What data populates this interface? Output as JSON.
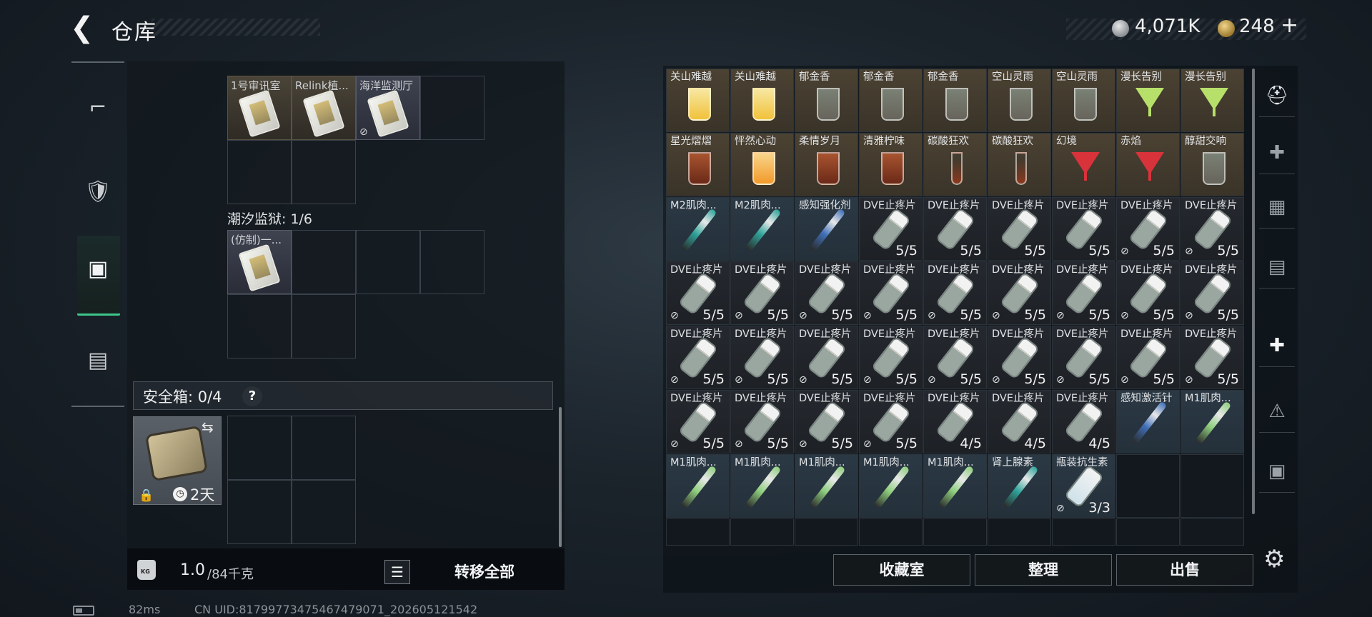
{
  "header": {
    "title": "仓库",
    "back_icon": "back-arrow-icon"
  },
  "currency": {
    "silver": "4,071K",
    "gold": "248",
    "gold_add": "+"
  },
  "left_nav": [
    {
      "name": "weapons",
      "icon": "pistol-icon",
      "glyph": "⌐"
    },
    {
      "name": "equipment",
      "icon": "armor-icon",
      "glyph": "🛡"
    },
    {
      "name": "backpack",
      "icon": "backpack-icon",
      "glyph": "▣"
    },
    {
      "name": "case",
      "icon": "briefcase-icon",
      "glyph": "▤"
    }
  ],
  "left_panel": {
    "section1_items": [
      {
        "label": "1号审讯室",
        "unpullable": false
      },
      {
        "label": "Relink植...",
        "unpullable": false
      },
      {
        "label": "海洋监测厅",
        "unpullable": true
      }
    ],
    "section2_title": "潮汐监狱: 1/6",
    "section2_items": [
      {
        "label": "(仿制)一..."
      }
    ],
    "safe_box_label": "安全箱: 0/4",
    "safe_box_help": "?",
    "case_days": "2天",
    "weight_value": "1.0",
    "weight_max": "/84千克",
    "transfer_all": "转移全部"
  },
  "footer": {
    "ping": "82ms",
    "uid": "CN UID:817997734754674790​71_202605121542"
  },
  "grid_rows": [
    [
      {
        "name": "关山难越",
        "type": "drink_yellow",
        "count": "",
        "nd": false
      },
      {
        "name": "关山难越",
        "type": "drink_yellow",
        "count": "",
        "nd": false
      },
      {
        "name": "郁金香",
        "type": "drink_clear",
        "count": "",
        "nd": false
      },
      {
        "name": "郁金香",
        "type": "drink_clear",
        "count": "",
        "nd": false
      },
      {
        "name": "郁金香",
        "type": "drink_clear",
        "count": "",
        "nd": false
      },
      {
        "name": "空山灵雨",
        "type": "drink_clear",
        "count": "",
        "nd": false
      },
      {
        "name": "空山灵雨",
        "type": "drink_clear",
        "count": "",
        "nd": false
      },
      {
        "name": "漫长告别",
        "type": "cocktail_green",
        "count": "",
        "nd": false
      },
      {
        "name": "漫长告别",
        "type": "cocktail_green",
        "count": "",
        "nd": false
      }
    ],
    [
      {
        "name": "星光熠熠",
        "type": "drink_dark",
        "count": "",
        "nd": false
      },
      {
        "name": "怦然心动",
        "type": "drink_orange",
        "count": "",
        "nd": false
      },
      {
        "name": "柔情岁月",
        "type": "drink_dark",
        "count": "",
        "nd": false
      },
      {
        "name": "清雅柠味",
        "type": "drink_dark",
        "count": "",
        "nd": false
      },
      {
        "name": "碳酸狂欢",
        "type": "flute",
        "count": "",
        "nd": false
      },
      {
        "name": "碳酸狂欢",
        "type": "flute",
        "count": "",
        "nd": false
      },
      {
        "name": "幻境",
        "type": "cocktail_red",
        "count": "",
        "nd": false
      },
      {
        "name": "赤焰",
        "type": "cocktail_red",
        "count": "",
        "nd": false
      },
      {
        "name": "醇甜交响",
        "type": "drink_clear",
        "count": "",
        "nd": false
      }
    ],
    [
      {
        "name": "M2肌肉...",
        "type": "injector_teal",
        "count": "",
        "nd": false
      },
      {
        "name": "M2肌肉...",
        "type": "injector_teal",
        "count": "",
        "nd": false
      },
      {
        "name": "感知强化剂",
        "type": "injector_blue",
        "count": "",
        "nd": false
      },
      {
        "name": "DVE止疼片",
        "type": "pill",
        "count": "5/5",
        "nd": false
      },
      {
        "name": "DVE止疼片",
        "type": "pill",
        "count": "5/5",
        "nd": false
      },
      {
        "name": "DVE止疼片",
        "type": "pill",
        "count": "5/5",
        "nd": false
      },
      {
        "name": "DVE止疼片",
        "type": "pill",
        "count": "5/5",
        "nd": false
      },
      {
        "name": "DVE止疼片",
        "type": "pill",
        "count": "5/5",
        "nd": true
      },
      {
        "name": "DVE止疼片",
        "type": "pill",
        "count": "5/5",
        "nd": true
      }
    ],
    [
      {
        "name": "DVE止疼片",
        "type": "pill",
        "count": "5/5",
        "nd": true
      },
      {
        "name": "DVE止疼片",
        "type": "pill",
        "count": "5/5",
        "nd": true
      },
      {
        "name": "DVE止疼片",
        "type": "pill",
        "count": "5/5",
        "nd": true
      },
      {
        "name": "DVE止疼片",
        "type": "pill",
        "count": "5/5",
        "nd": true
      },
      {
        "name": "DVE止疼片",
        "type": "pill",
        "count": "5/5",
        "nd": true
      },
      {
        "name": "DVE止疼片",
        "type": "pill",
        "count": "5/5",
        "nd": true
      },
      {
        "name": "DVE止疼片",
        "type": "pill",
        "count": "5/5",
        "nd": true
      },
      {
        "name": "DVE止疼片",
        "type": "pill",
        "count": "5/5",
        "nd": true
      },
      {
        "name": "DVE止疼片",
        "type": "pill",
        "count": "5/5",
        "nd": true
      }
    ],
    [
      {
        "name": "DVE止疼片",
        "type": "pill",
        "count": "5/5",
        "nd": true
      },
      {
        "name": "DVE止疼片",
        "type": "pill",
        "count": "5/5",
        "nd": true
      },
      {
        "name": "DVE止疼片",
        "type": "pill",
        "count": "5/5",
        "nd": true
      },
      {
        "name": "DVE止疼片",
        "type": "pill",
        "count": "5/5",
        "nd": true
      },
      {
        "name": "DVE止疼片",
        "type": "pill",
        "count": "5/5",
        "nd": true
      },
      {
        "name": "DVE止疼片",
        "type": "pill",
        "count": "5/5",
        "nd": true
      },
      {
        "name": "DVE止疼片",
        "type": "pill",
        "count": "5/5",
        "nd": true
      },
      {
        "name": "DVE止疼片",
        "type": "pill",
        "count": "5/5",
        "nd": true
      },
      {
        "name": "DVE止疼片",
        "type": "pill",
        "count": "5/5",
        "nd": true
      }
    ],
    [
      {
        "name": "DVE止疼片",
        "type": "pill",
        "count": "5/5",
        "nd": true
      },
      {
        "name": "DVE止疼片",
        "type": "pill",
        "count": "5/5",
        "nd": true
      },
      {
        "name": "DVE止疼片",
        "type": "pill",
        "count": "5/5",
        "nd": true
      },
      {
        "name": "DVE止疼片",
        "type": "pill",
        "count": "5/5",
        "nd": true
      },
      {
        "name": "DVE止疼片",
        "type": "pill",
        "count": "4/5",
        "nd": false
      },
      {
        "name": "DVE止疼片",
        "type": "pill",
        "count": "4/5",
        "nd": false
      },
      {
        "name": "DVE止疼片",
        "type": "pill",
        "count": "4/5",
        "nd": false
      },
      {
        "name": "感知激活针",
        "type": "injector_blue",
        "count": "",
        "nd": false
      },
      {
        "name": "M1肌肉...",
        "type": "injector_green",
        "count": "",
        "nd": false
      }
    ],
    [
      {
        "name": "M1肌肉...",
        "type": "injector_green",
        "count": "",
        "nd": false
      },
      {
        "name": "M1肌肉...",
        "type": "injector_green",
        "count": "",
        "nd": false
      },
      {
        "name": "M1肌肉...",
        "type": "injector_green",
        "count": "",
        "nd": false
      },
      {
        "name": "M1肌肉...",
        "type": "injector_green",
        "count": "",
        "nd": false
      },
      {
        "name": "M1肌肉...",
        "type": "injector_green",
        "count": "",
        "nd": false
      },
      {
        "name": "肾上腺素",
        "type": "injector_teal",
        "count": "",
        "nd": false
      },
      {
        "name": "瓶装抗生素",
        "type": "bottle",
        "count": "3/3",
        "nd": true
      },
      {
        "name": "",
        "type": "empty",
        "count": "",
        "nd": false
      },
      {
        "name": "",
        "type": "empty",
        "count": "",
        "nd": false
      }
    ]
  ],
  "right_buttons": {
    "collection": "收藏室",
    "sort": "整理",
    "sell": "出售"
  },
  "right_nav": [
    {
      "name": "helmet",
      "icon": "helmet-icon",
      "glyph": "⛑"
    },
    {
      "name": "slot-iv-plus-1",
      "icon": "iv-plus-icon",
      "glyph": "✚"
    },
    {
      "name": "slot-v",
      "icon": "v-slot-icon",
      "glyph": "▦"
    },
    {
      "name": "slot-iv-2",
      "icon": "iv-slot-icon",
      "glyph": "▤"
    },
    {
      "name": "slot-iv-plus-2",
      "icon": "iv-plus-active-icon",
      "glyph": "✚"
    },
    {
      "name": "slot-warning",
      "icon": "warning-box-icon",
      "glyph": "⚠"
    },
    {
      "name": "slot-camera",
      "icon": "camera-box-icon",
      "glyph": "▣"
    }
  ]
}
